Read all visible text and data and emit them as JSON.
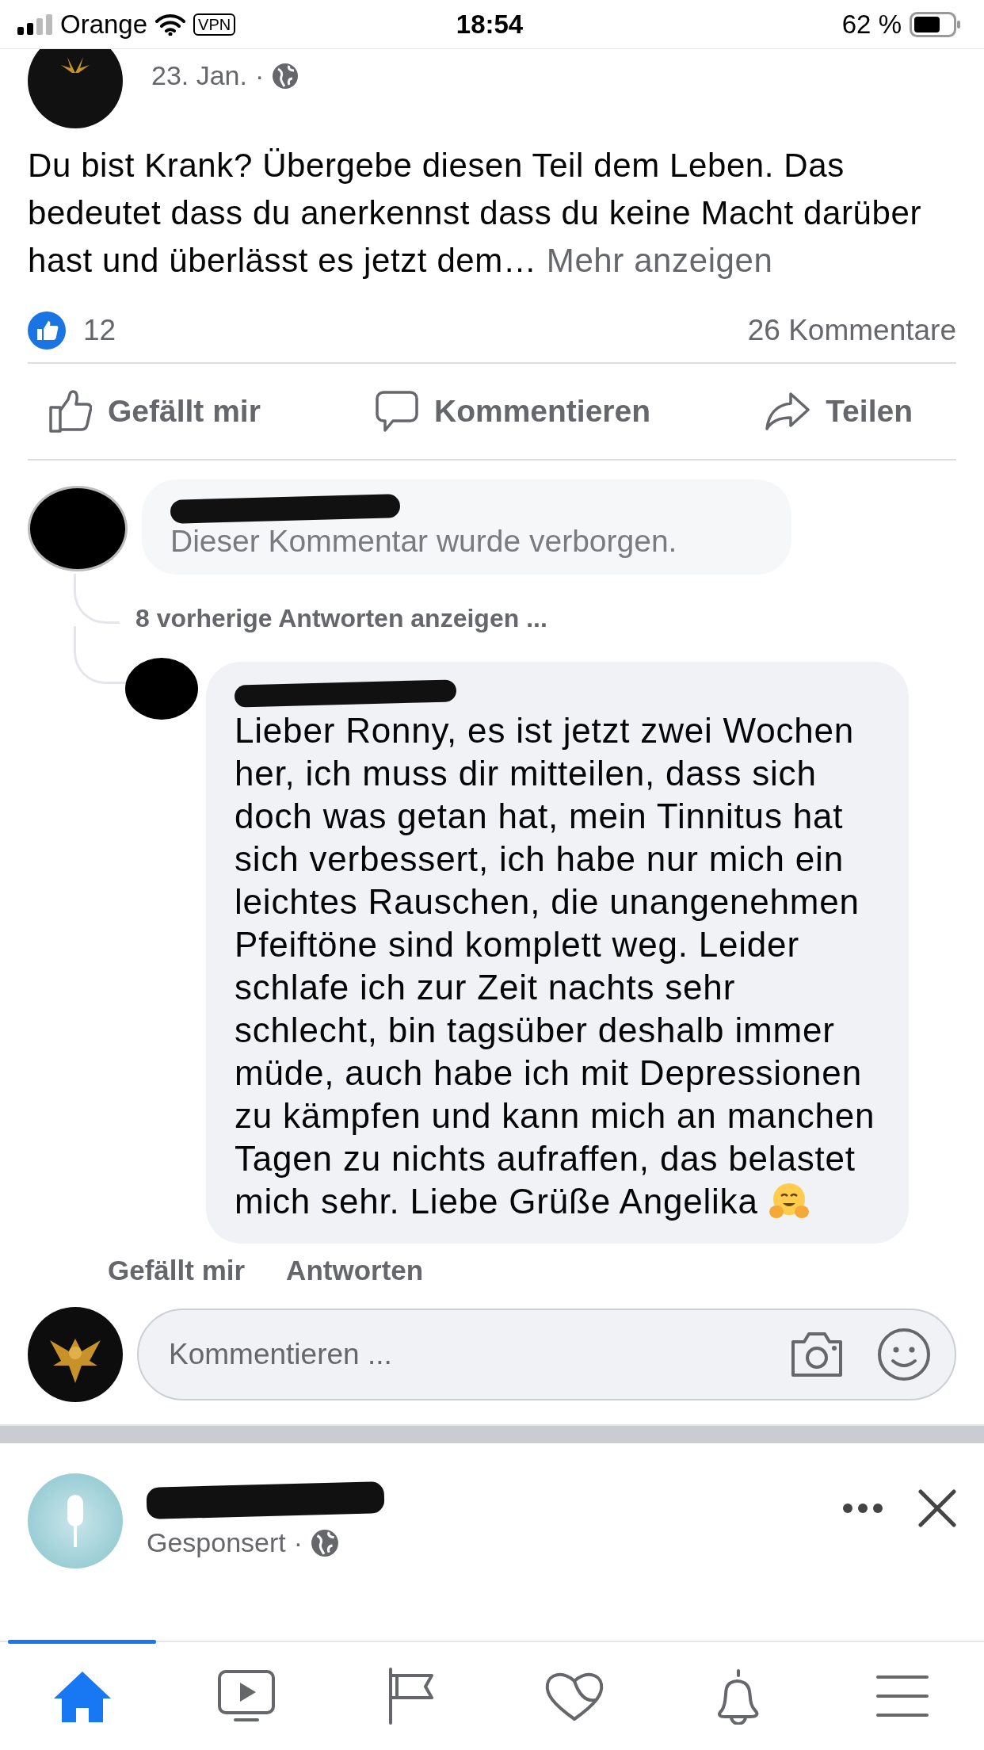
{
  "status_bar": {
    "carrier": "Orange",
    "vpn": "VPN",
    "time": "18:54",
    "battery": "62 %"
  },
  "post": {
    "date": "23. Jan.",
    "separator": "·",
    "text": "Du bist Krank? Übergebe diesen Teil dem Leben. Das bedeutet dass du anerkennst dass du keine Macht darüber hast und überlässt es jetzt dem…",
    "more": "Mehr anzeigen",
    "like_count": "12",
    "comment_count": "26 Kommentare",
    "actions": [
      {
        "kind": "like",
        "label": "Gefällt mir"
      },
      {
        "kind": "comment",
        "label": "Kommentieren"
      },
      {
        "kind": "share",
        "label": "Teilen"
      }
    ]
  },
  "hidden_comment": {
    "text": "Dieser Kommentar wurde verborgen."
  },
  "more_replies": "8 vorherige Antworten anzeigen ...",
  "reply": {
    "text": "Lieber Ronny, es ist jetzt zwei Wochen her, ich muss dir mitteilen, dass sich doch was getan hat, mein Tinnitus hat sich verbessert, ich habe nur mich ein leichtes Rauschen, die unangenehmen Pfeiftöne sind komplett weg. Leider schlafe ich zur Zeit nachts sehr schlecht, bin tagsüber deshalb immer müde, auch habe ich mit Depressionen zu kämpfen und kann mich an manchen Tagen zu nichts aufraffen, das belastet mich sehr. Liebe Grüße Angelika",
    "actions": [
      "Gefällt mir",
      "Antworten"
    ]
  },
  "composer": {
    "placeholder": "Kommentieren ..."
  },
  "sponsored": {
    "label": "Gesponsert",
    "separator": "·"
  },
  "tab_bar": [
    {
      "kind": "home",
      "selected": true
    },
    {
      "kind": "video",
      "selected": false
    },
    {
      "kind": "pages",
      "selected": false
    },
    {
      "kind": "dating",
      "selected": false
    },
    {
      "kind": "notifications",
      "selected": false
    },
    {
      "kind": "menu",
      "selected": false
    }
  ]
}
